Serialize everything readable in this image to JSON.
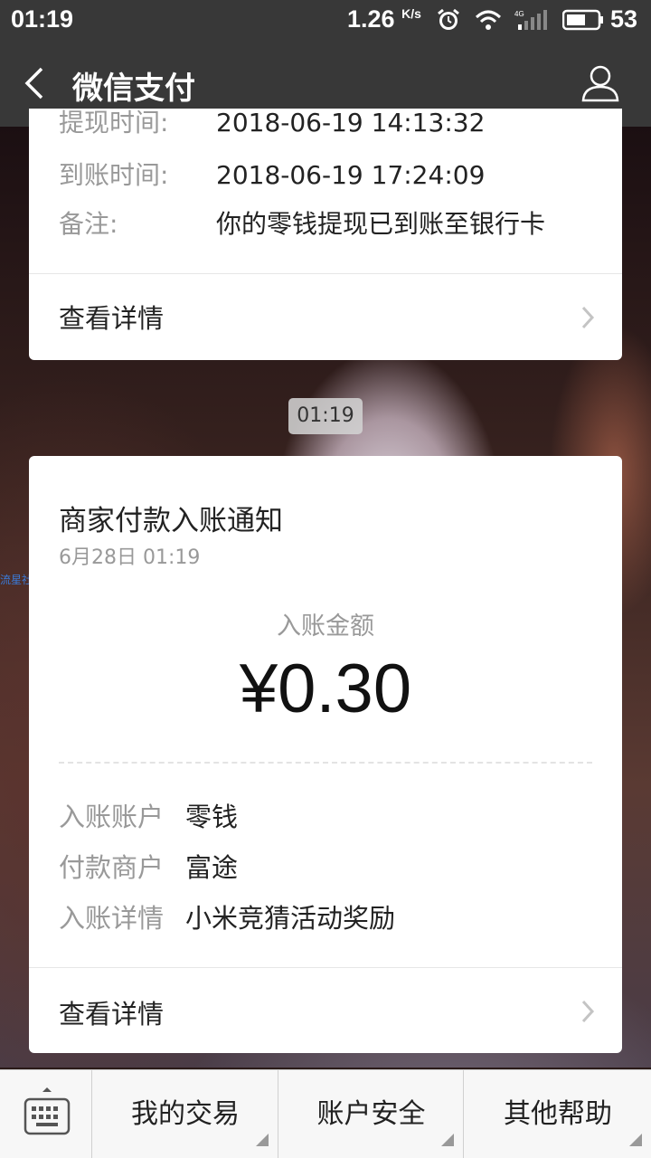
{
  "status_bar": {
    "time": "01:19",
    "speed": "1.26",
    "speed_unit": "K/s",
    "battery": "53"
  },
  "nav": {
    "title": "微信支付"
  },
  "card1": {
    "cut_row_value": "2018-06-19 14:13:32",
    "rows": [
      {
        "label": "到账时间:",
        "value": "2018-06-19 17:24:09"
      },
      {
        "label": "备注:",
        "value": "你的零钱提现已到账至银行卡"
      }
    ],
    "detail": "查看详情"
  },
  "timestamp_pill": "01:19",
  "watermark": "流星社区",
  "card2": {
    "title": "商家付款入账通知",
    "date": "6月28日  01:19",
    "amount_label": "入账金额",
    "amount": "¥0.30",
    "rows": [
      {
        "label": "入账账户",
        "value": "零钱"
      },
      {
        "label": "付款商户",
        "value": "富途"
      },
      {
        "label": "入账详情",
        "value": "小米竞猜活动奖励"
      }
    ],
    "detail": "查看详情"
  },
  "bottom_menu": {
    "items": [
      "我的交易",
      "账户安全",
      "其他帮助"
    ]
  }
}
